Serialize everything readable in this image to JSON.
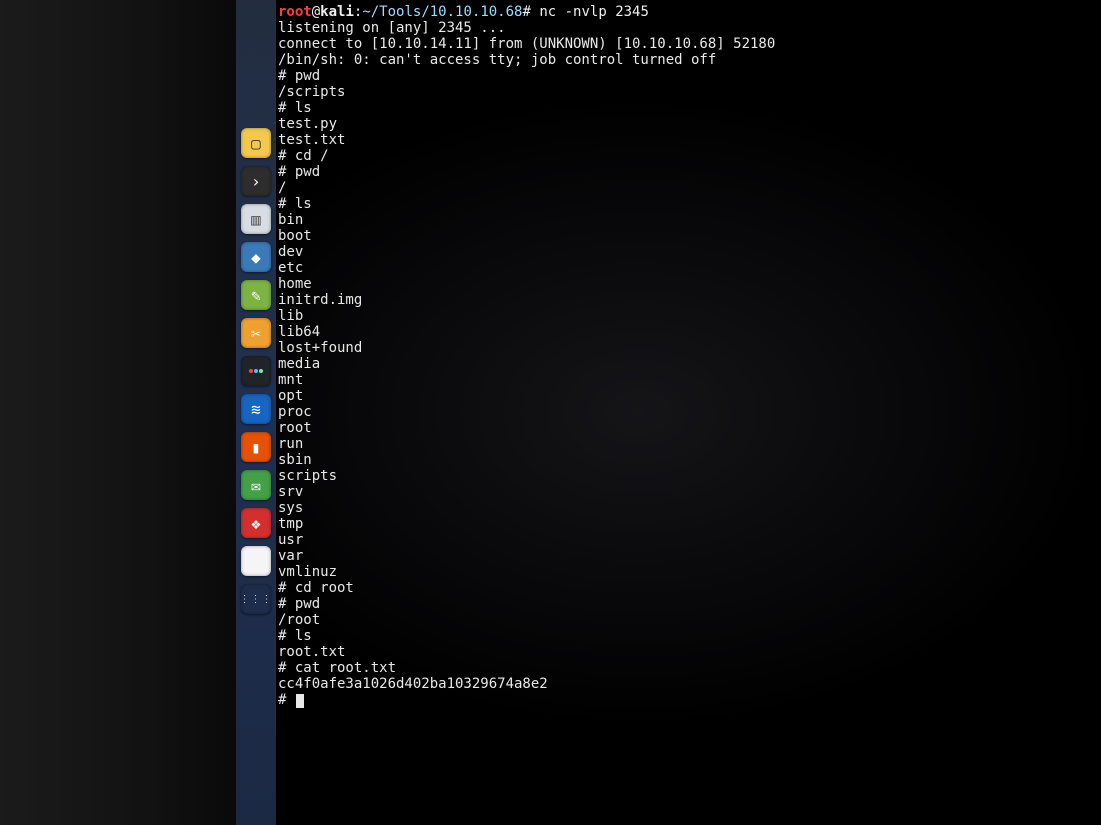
{
  "prompt": {
    "user": "root",
    "at": "@",
    "host": "kali",
    "sep": ":",
    "cwd": "~/Tools/10.10.10.68",
    "hash": "#",
    "cmd0": "nc -nvlp 2345"
  },
  "terminal_lines": [
    "listening on [any] 2345 ...",
    "connect to [10.10.14.11] from (UNKNOWN) [10.10.10.68] 52180",
    "/bin/sh: 0: can't access tty; job control turned off",
    "# pwd",
    "/scripts",
    "# ls",
    "test.py",
    "test.txt",
    "# cd /",
    "# pwd",
    "/",
    "# ls",
    "bin",
    "boot",
    "dev",
    "etc",
    "home",
    "initrd.img",
    "lib",
    "lib64",
    "lost+found",
    "media",
    "mnt",
    "opt",
    "proc",
    "root",
    "run",
    "sbin",
    "scripts",
    "srv",
    "sys",
    "tmp",
    "usr",
    "var",
    "vmlinuz",
    "# cd root",
    "# pwd",
    "/root",
    "# ls",
    "root.txt",
    "# cat root.txt",
    "cc4f0afe3a1026d402ba10329674a8e2"
  ],
  "current_prompt": "# ",
  "dock": {
    "items": [
      {
        "name": "app-launcher",
        "color": "#f2c94c",
        "glyph": "▢"
      },
      {
        "name": "terminal-app",
        "color": "#2d2d2d",
        "glyph": ">"
      },
      {
        "name": "files-app",
        "color": "#d8dde3",
        "glyph": "▥"
      },
      {
        "name": "security-app",
        "color": "#3b7ab8",
        "glyph": "◆"
      },
      {
        "name": "text-editor",
        "color": "#7cb342",
        "glyph": "✎"
      },
      {
        "name": "screenshot-app",
        "color": "#f0a030",
        "glyph": "✂"
      },
      {
        "name": "color-app",
        "color": "#202428",
        "glyph": "●"
      },
      {
        "name": "network-app",
        "color": "#1565c0",
        "glyph": "≋"
      },
      {
        "name": "notes-app",
        "color": "#e65100",
        "glyph": "▮"
      },
      {
        "name": "chat-app",
        "color": "#43a047",
        "glyph": "✉"
      },
      {
        "name": "desktop-app",
        "color": "#d32f2f",
        "glyph": "❖"
      },
      {
        "name": "blank-app",
        "color": "#f5f5f5",
        "glyph": " "
      },
      {
        "name": "apps-grid",
        "color": "transparent",
        "glyph": "⋮⋮⋮"
      }
    ]
  }
}
